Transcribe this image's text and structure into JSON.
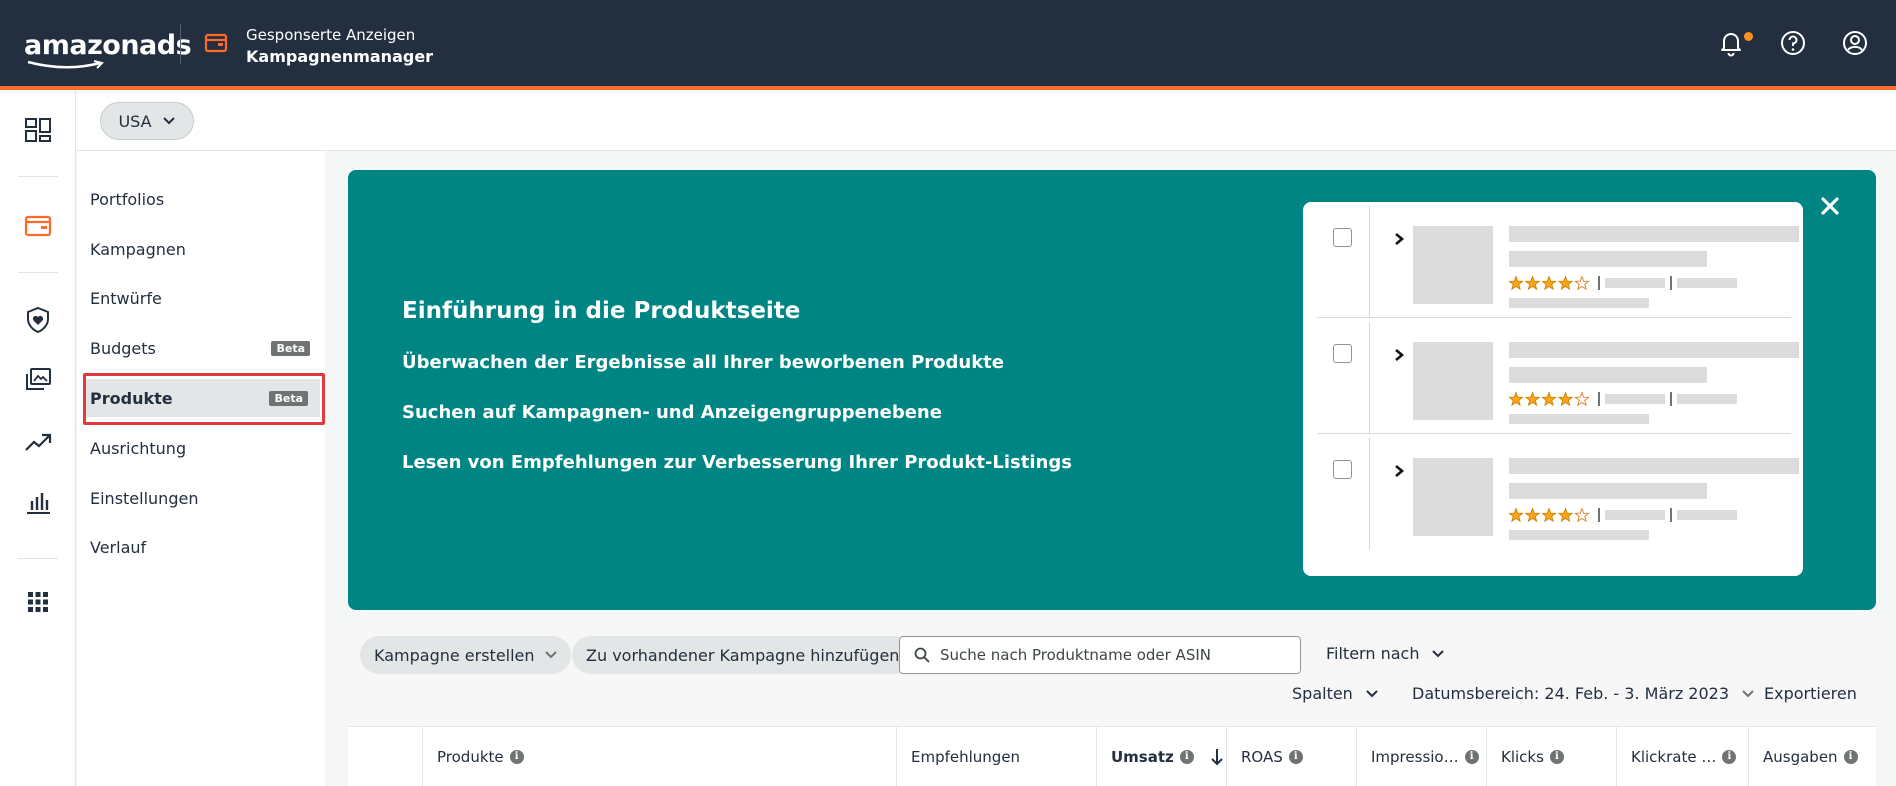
{
  "header": {
    "brand": "amazonads",
    "product_subtitle": "Gesponserte Anzeigen",
    "product_title": "Kampagnenmanager"
  },
  "country": {
    "selected": "USA"
  },
  "nav": {
    "items": [
      {
        "label": "Portfolios"
      },
      {
        "label": "Kampagnen"
      },
      {
        "label": "Entwürfe"
      },
      {
        "label": "Budgets",
        "badge": "Beta"
      },
      {
        "label": "Produkte",
        "badge": "Beta",
        "active": true
      },
      {
        "label": "Ausrichtung"
      },
      {
        "label": "Einstellungen"
      },
      {
        "label": "Verlauf"
      }
    ]
  },
  "banner": {
    "title": "Einführung in die Produktseite",
    "lines": [
      "Überwachen der Ergebnisse all Ihrer beworbenen Produkte",
      "Suchen auf Kampagnen- und Anzeigengruppenebene",
      "Lesen von Empfehlungen zur Verbesserung Ihrer Produkt-Listings"
    ],
    "preview_rating": 4,
    "preview_rating_max": 5,
    "colors": {
      "background": "#008585",
      "star": "#ffa41c"
    }
  },
  "toolbar": {
    "create_campaign": "Kampagne erstellen",
    "add_to_campaign": "Zu vorhandener Kampagne hinzufügen",
    "search_placeholder": "Suche nach Produktname oder ASIN",
    "filter": "Filtern nach",
    "columns": "Spalten",
    "date_range": "Datumsbereich: 24. Feb. - 3. März 2023",
    "export": "Exportieren"
  },
  "table": {
    "columns": [
      {
        "label": "Produkte",
        "info": true
      },
      {
        "label": "Empfehlungen"
      },
      {
        "label": "Umsatz",
        "info": true,
        "sorted": "desc"
      },
      {
        "label": "ROAS",
        "info": true
      },
      {
        "label": "Impressio…",
        "info": true
      },
      {
        "label": "Klicks",
        "info": true
      },
      {
        "label": "Klickrate …",
        "info": true
      },
      {
        "label": "Ausgaben",
        "info": true
      }
    ]
  },
  "colors": {
    "header": "#232f3e",
    "accent": "#ff6a2a",
    "highlight": "#e0393e",
    "notification_dot": "#ff8f1c"
  },
  "icons": [
    "bell-icon",
    "help-icon",
    "account-icon",
    "dashboard-icon",
    "campaign-wallet-icon",
    "shield-icon",
    "media-icon",
    "trend-icon",
    "bar-chart-icon",
    "apps-grid-icon",
    "close-icon",
    "search-icon",
    "chevron-down-icon",
    "sort-arrow-icon",
    "info-icon"
  ]
}
